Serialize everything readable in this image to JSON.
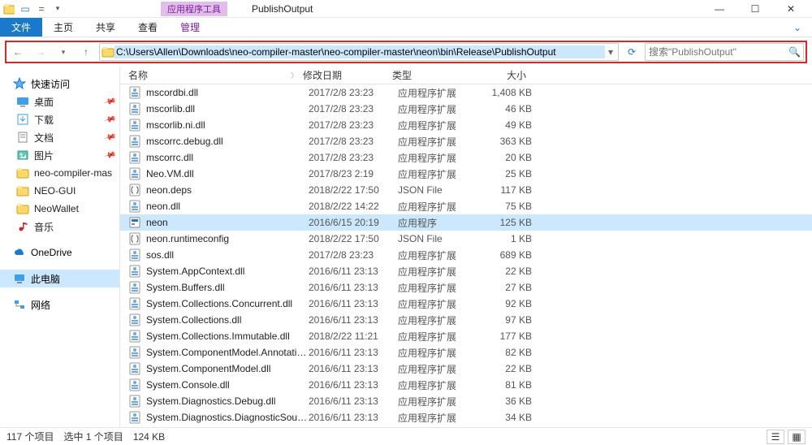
{
  "window": {
    "title": "PublishOutput",
    "tooltab": "应用程序工具",
    "tooltab_sub": "管理"
  },
  "ribbon": {
    "file": "文件",
    "tabs": [
      "主页",
      "共享",
      "查看"
    ]
  },
  "nav": {
    "path": "C:\\Users\\Allen\\Downloads\\neo-compiler-master\\neo-compiler-master\\neon\\bin\\Release\\PublishOutput",
    "search_placeholder": "搜索\"PublishOutput\""
  },
  "sidebar": {
    "quickaccess": "快速访问",
    "pins": [
      "桌面",
      "下载",
      "文档",
      "图片"
    ],
    "folders": [
      "neo-compiler-mas",
      "NEO-GUI",
      "NeoWallet",
      "音乐"
    ],
    "onedrive": "OneDrive",
    "thispc": "此电脑",
    "network": "网络"
  },
  "columns": {
    "name": "名称",
    "date": "修改日期",
    "type": "类型",
    "size": "大小"
  },
  "files": [
    {
      "icon": "dll",
      "name": "mscordbi.dll",
      "date": "2017/2/8 23:23",
      "type": "应用程序扩展",
      "size": "1,408 KB"
    },
    {
      "icon": "dll",
      "name": "mscorlib.dll",
      "date": "2017/2/8 23:23",
      "type": "应用程序扩展",
      "size": "46 KB"
    },
    {
      "icon": "dll",
      "name": "mscorlib.ni.dll",
      "date": "2017/2/8 23:23",
      "type": "应用程序扩展",
      "size": "49 KB"
    },
    {
      "icon": "dll",
      "name": "mscorrc.debug.dll",
      "date": "2017/2/8 23:23",
      "type": "应用程序扩展",
      "size": "363 KB"
    },
    {
      "icon": "dll",
      "name": "mscorrc.dll",
      "date": "2017/2/8 23:23",
      "type": "应用程序扩展",
      "size": "20 KB"
    },
    {
      "icon": "dll",
      "name": "Neo.VM.dll",
      "date": "2017/8/23 2:19",
      "type": "应用程序扩展",
      "size": "25 KB"
    },
    {
      "icon": "json",
      "name": "neon.deps",
      "date": "2018/2/22 17:50",
      "type": "JSON File",
      "size": "117 KB"
    },
    {
      "icon": "dll",
      "name": "neon.dll",
      "date": "2018/2/22 14:22",
      "type": "应用程序扩展",
      "size": "75 KB"
    },
    {
      "icon": "exe",
      "name": "neon",
      "date": "2016/6/15 20:19",
      "type": "应用程序",
      "size": "125 KB",
      "sel": true
    },
    {
      "icon": "json",
      "name": "neon.runtimeconfig",
      "date": "2018/2/22 17:50",
      "type": "JSON File",
      "size": "1 KB"
    },
    {
      "icon": "dll",
      "name": "sos.dll",
      "date": "2017/2/8 23:23",
      "type": "应用程序扩展",
      "size": "689 KB"
    },
    {
      "icon": "dll",
      "name": "System.AppContext.dll",
      "date": "2016/6/11 23:13",
      "type": "应用程序扩展",
      "size": "22 KB"
    },
    {
      "icon": "dll",
      "name": "System.Buffers.dll",
      "date": "2016/6/11 23:13",
      "type": "应用程序扩展",
      "size": "27 KB"
    },
    {
      "icon": "dll",
      "name": "System.Collections.Concurrent.dll",
      "date": "2016/6/11 23:13",
      "type": "应用程序扩展",
      "size": "92 KB"
    },
    {
      "icon": "dll",
      "name": "System.Collections.dll",
      "date": "2016/6/11 23:13",
      "type": "应用程序扩展",
      "size": "97 KB"
    },
    {
      "icon": "dll",
      "name": "System.Collections.Immutable.dll",
      "date": "2018/2/22 11:21",
      "type": "应用程序扩展",
      "size": "177 KB"
    },
    {
      "icon": "dll",
      "name": "System.ComponentModel.Annotatio...",
      "date": "2016/6/11 23:13",
      "type": "应用程序扩展",
      "size": "82 KB"
    },
    {
      "icon": "dll",
      "name": "System.ComponentModel.dll",
      "date": "2016/6/11 23:13",
      "type": "应用程序扩展",
      "size": "22 KB"
    },
    {
      "icon": "dll",
      "name": "System.Console.dll",
      "date": "2016/6/11 23:13",
      "type": "应用程序扩展",
      "size": "81 KB"
    },
    {
      "icon": "dll",
      "name": "System.Diagnostics.Debug.dll",
      "date": "2016/6/11 23:13",
      "type": "应用程序扩展",
      "size": "36 KB"
    },
    {
      "icon": "dll",
      "name": "System.Diagnostics.DiagnosticSourc...",
      "date": "2016/6/11 23:13",
      "type": "应用程序扩展",
      "size": "34 KB"
    }
  ],
  "status": {
    "items": "117 个项目",
    "selected": "选中 1 个项目",
    "sel_size": "124 KB"
  }
}
